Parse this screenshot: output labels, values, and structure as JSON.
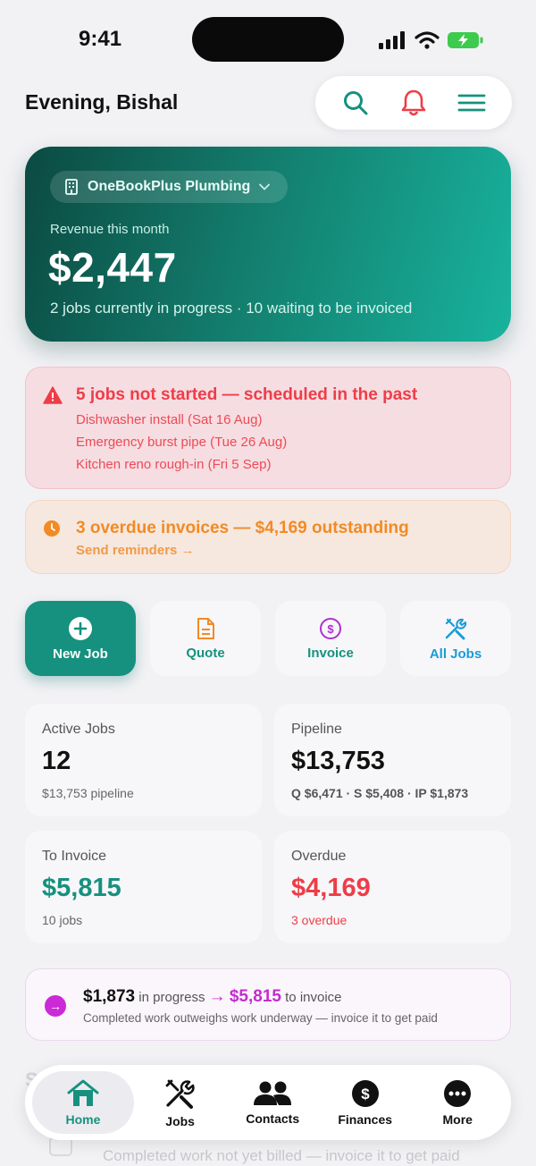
{
  "status_bar": {
    "time": "9:41"
  },
  "header": {
    "greeting": "Evening, Bishal"
  },
  "hero": {
    "business_name": "OneBookPlus Plumbing",
    "revenue_label": "Revenue this month",
    "revenue_value": "$2,447",
    "summary": "2 jobs currently in progress · 10 waiting to be invoiced"
  },
  "alert_jobs": {
    "title": "5 jobs not started — scheduled in the past",
    "items": [
      "Dishwasher install (Sat 16 Aug)",
      "Emergency burst pipe (Tue 26 Aug)",
      "Kitchen reno rough-in (Fri 5 Sep)"
    ]
  },
  "alert_invoices": {
    "title": "3 overdue invoices — $4,169 outstanding",
    "link": "Send reminders →"
  },
  "quick_actions": [
    {
      "label": "New Job",
      "icon": "plus-circle-icon"
    },
    {
      "label": "Quote",
      "icon": "document-icon"
    },
    {
      "label": "Invoice",
      "icon": "dollar-circle-icon"
    },
    {
      "label": "All Jobs",
      "icon": "tools-icon"
    }
  ],
  "stats": {
    "active": {
      "label": "Active Jobs",
      "value": "12",
      "sub": "$13,753 pipeline"
    },
    "pipeline": {
      "label": "Pipeline",
      "value": "$13,753",
      "sub": "Q $6,471 · S $5,408 · IP $1,873"
    },
    "to_invoice": {
      "label": "To Invoice",
      "value": "$5,815",
      "sub": "10 jobs"
    },
    "overdue": {
      "label": "Overdue",
      "value": "$4,169",
      "sub": "3 overdue"
    }
  },
  "banner": {
    "amount_progress": "$1,873",
    "in_progress_text": " in progress ",
    "arrow": "→",
    "amount_invoice": "$5,815",
    "to_invoice_text": " to invoice",
    "description": "Completed work outweighs work underway — invoice it to get paid"
  },
  "peek": {
    "title": "S",
    "text": "Completed work not yet billed — invoice it to get paid"
  },
  "tabs": [
    {
      "label": "Home",
      "icon": "home-icon"
    },
    {
      "label": "Jobs",
      "icon": "tools-icon"
    },
    {
      "label": "Contacts",
      "icon": "people-icon"
    },
    {
      "label": "Finances",
      "icon": "dollar-circle-icon"
    },
    {
      "label": "More",
      "icon": "more-icon"
    }
  ],
  "colors": {
    "accent": "#16917f",
    "danger": "#ee3d48",
    "warning": "#f28a25",
    "magenta": "#c42ccf"
  }
}
